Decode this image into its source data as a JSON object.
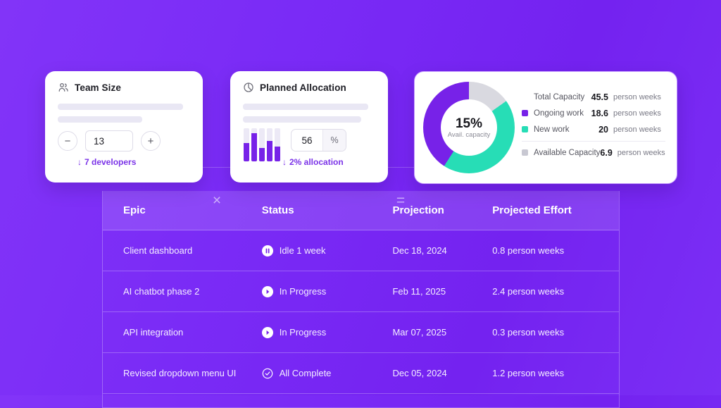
{
  "theme": {
    "bg_left": "#8234f8",
    "bg_right": "#7422f0",
    "accent_purple": "#7722e8",
    "accent_teal": "#27ddb6",
    "accent_gray": "#d9d9e0",
    "link_purple": "#7b33e8"
  },
  "operators": {
    "multiply": "×",
    "equals": "="
  },
  "cards": {
    "team_size": {
      "icon": "users-icon",
      "title": "Team Size",
      "decrement_label": "−",
      "increment_label": "+",
      "value": "13",
      "delta_arrow": "↓",
      "delta_text": "7 developers"
    },
    "planned_allocation": {
      "icon": "pie-chart-icon",
      "title": "Planned Allocation",
      "value": "56",
      "unit": "%",
      "delta_arrow": "↓",
      "delta_text": "2% allocation",
      "bars": [
        55,
        85,
        40,
        62,
        45
      ]
    },
    "result": {
      "donut": {
        "center_value": "15%",
        "center_label": "Avail. capacity"
      },
      "legend": [
        {
          "swatch": "none",
          "label": "Total Capacity",
          "value": "45.5",
          "unit": "person weeks"
        },
        {
          "swatch": "#7722e8",
          "label": "Ongoing work",
          "value": "18.6",
          "unit": "person weeks"
        },
        {
          "swatch": "#27ddb6",
          "label": "New work",
          "value": "20",
          "unit": "person weeks"
        },
        {
          "swatch": "#c8c8d2",
          "label": "Available Capacity",
          "value": "6.9",
          "unit": "person weeks"
        }
      ]
    }
  },
  "chart_data": {
    "type": "pie",
    "title": "Avail. capacity",
    "labels": [
      "Available Capacity",
      "New work",
      "Ongoing work"
    ],
    "values": [
      6.9,
      20,
      18.6
    ],
    "colors": [
      "#d9d9e0",
      "#27ddb6",
      "#7722e8"
    ],
    "unit": "person weeks",
    "total": 45.5,
    "center_value": "15%",
    "center_label": "Avail. capacity",
    "legend": "right"
  },
  "table": {
    "columns": [
      "Epic",
      "Status",
      "Projection",
      "Projected Effort"
    ],
    "rows": [
      {
        "epic": "Client dashboard",
        "status_icon": "pause-circle-icon",
        "status": "Idle 1 week",
        "projection": "Dec 18, 2024",
        "effort": "0.8 person weeks"
      },
      {
        "epic": "AI chatbot phase 2",
        "status_icon": "play-circle-icon",
        "status": "In Progress",
        "projection": "Feb 11, 2025",
        "effort": "2.4 person weeks"
      },
      {
        "epic": "API integration",
        "status_icon": "play-circle-icon",
        "status": "In Progress",
        "projection": "Mar 07, 2025",
        "effort": "0.3 person weeks"
      },
      {
        "epic": "Revised dropdown menu UI",
        "status_icon": "check-circle-icon",
        "status": "All Complete",
        "projection": "Dec 05, 2024",
        "effort": "1.2 person weeks"
      }
    ]
  }
}
